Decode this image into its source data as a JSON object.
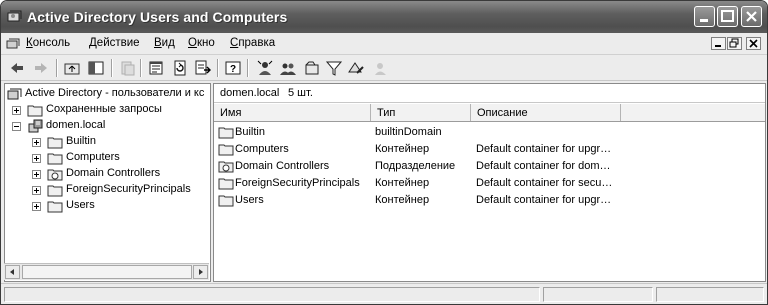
{
  "window": {
    "title": "Active Directory Users and Computers"
  },
  "menu": {
    "items": [
      {
        "label": "Консоль",
        "accel": "К",
        "rest": "онсоль"
      },
      {
        "label": "Действие",
        "accel": "Д",
        "rest": "ействие"
      },
      {
        "label": "Вид",
        "accel": "В",
        "rest": "ид"
      },
      {
        "label": "Окно",
        "accel": "О",
        "rest": "кно"
      },
      {
        "label": "Справка",
        "accel": "С",
        "rest": "правка"
      }
    ]
  },
  "tree": {
    "root": "Active Directory - пользователи и кс",
    "saved_queries": "Сохраненные запросы",
    "domain": "domen.local",
    "children": [
      "Builtin",
      "Computers",
      "Domain Controllers",
      "ForeignSecurityPrincipals",
      "Users"
    ]
  },
  "details": {
    "location": "domen.local",
    "count": "5 шт.",
    "columns": {
      "name": "Имя",
      "type": "Тип",
      "description": "Описание"
    },
    "rows": [
      {
        "name": "Builtin",
        "type": "builtinDomain",
        "description": "",
        "icon": "folder-icon"
      },
      {
        "name": "Computers",
        "type": "Контейнер",
        "description": "Default container for upgr…",
        "icon": "folder-icon"
      },
      {
        "name": "Domain Controllers",
        "type": "Подразделение",
        "description": "Default container for dom…",
        "icon": "ou-icon"
      },
      {
        "name": "ForeignSecurityPrincipals",
        "type": "Контейнер",
        "description": "Default container for secu…",
        "icon": "folder-icon"
      },
      {
        "name": "Users",
        "type": "Контейнер",
        "description": "Default container for upgr…",
        "icon": "folder-icon"
      }
    ]
  }
}
